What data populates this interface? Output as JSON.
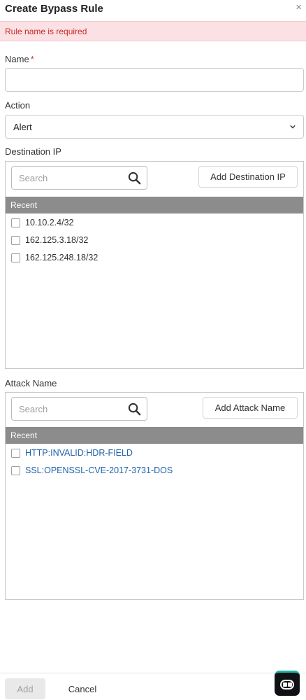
{
  "header": {
    "title": "Create Bypass Rule",
    "close_icon": "×"
  },
  "error": {
    "message": "Rule name is required"
  },
  "name_field": {
    "label": "Name",
    "required_mark": "*",
    "value": ""
  },
  "action_field": {
    "label": "Action",
    "selected": "Alert"
  },
  "destination_ip": {
    "label": "Destination IP",
    "search_placeholder": "Search",
    "add_button": "Add Destination IP",
    "recent_header": "Recent",
    "items": [
      "10.10.2.4/32",
      "162.125.3.18/32",
      "162.125.248.18/32"
    ]
  },
  "attack_name": {
    "label": "Attack Name",
    "search_placeholder": "Search",
    "add_button": "Add Attack Name",
    "recent_header": "Recent",
    "items": [
      "HTTP:INVALID:HDR-FIELD",
      "SSL:OPENSSL-CVE-2017-3731-DOS"
    ]
  },
  "footer": {
    "add_label": "Add",
    "cancel_label": "Cancel"
  },
  "colors": {
    "error_bg": "#fbe1e3",
    "error_text": "#c62828",
    "link": "#1e63a8",
    "recent_bar": "#8c8c8c",
    "bot_accent": "#1bb3a3"
  },
  "icons": {
    "search": "search-icon",
    "chevron": "chevron-down-icon",
    "close": "close-icon",
    "assistant": "assistant-bot-icon"
  }
}
